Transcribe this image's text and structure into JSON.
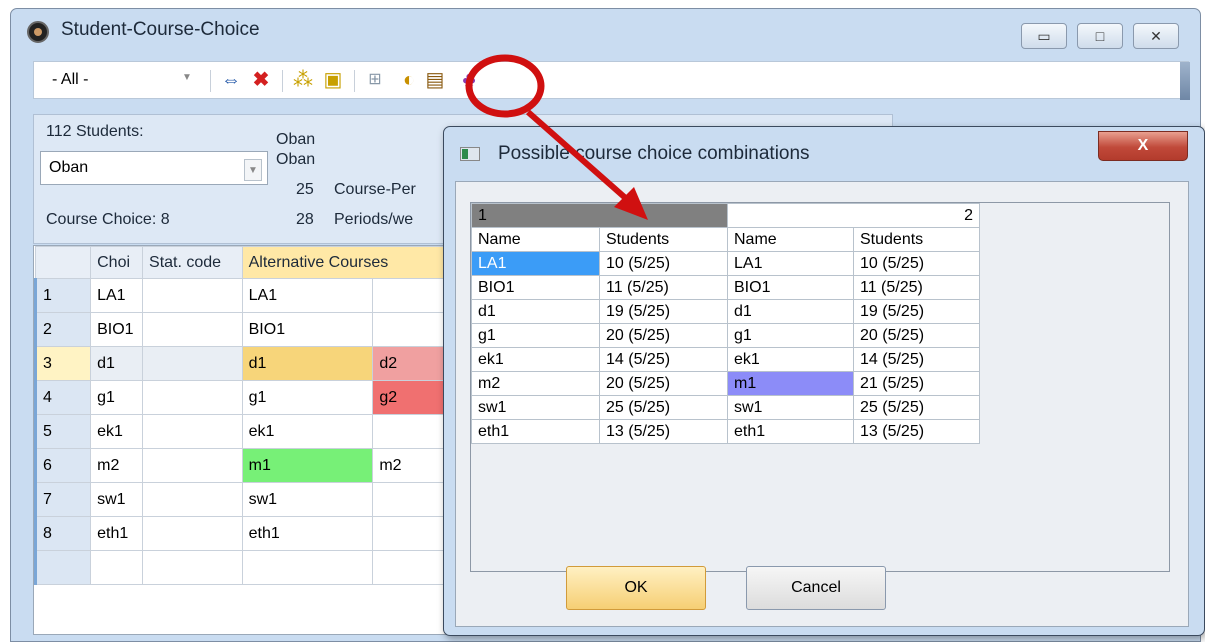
{
  "window": {
    "title": "Student-Course-Choice",
    "minimize_label": "▭",
    "maximize_label": "□",
    "close_label": "✕"
  },
  "toolbar": {
    "filter_value": "- All -"
  },
  "panel": {
    "students_count": "112 Students:",
    "class_value": "Oban",
    "name1": "Oban",
    "name2": "Oban",
    "num1": "25",
    "label1": "Course-Per",
    "num2": "28",
    "label2": "Periods/we",
    "course_choice": "Course Choice: 8"
  },
  "grid": {
    "headers": [
      "",
      "Choi",
      "Stat. code",
      "Alternative Courses",
      ""
    ],
    "rows": [
      {
        "n": "1",
        "choice": "LA1",
        "alt": "LA1",
        "alt2": ""
      },
      {
        "n": "2",
        "choice": "BIO1",
        "alt": "BIO1",
        "alt2": ""
      },
      {
        "n": "3",
        "choice": "d1",
        "alt": "d1",
        "alt2": "d2"
      },
      {
        "n": "4",
        "choice": "g1",
        "alt": "g1",
        "alt2": "g2"
      },
      {
        "n": "5",
        "choice": "ek1",
        "alt": "ek1",
        "alt2": ""
      },
      {
        "n": "6",
        "choice": "m2",
        "alt": "m1",
        "alt2": "m2"
      },
      {
        "n": "7",
        "choice": "sw1",
        "alt": "sw1",
        "alt2": ""
      },
      {
        "n": "8",
        "choice": "eth1",
        "alt": "eth1",
        "alt2": ""
      }
    ]
  },
  "dialog": {
    "title": "Possible course choice combinations",
    "close_label": "X",
    "group1": "1",
    "group2": "2",
    "col_name": "Name",
    "col_students": "Students",
    "rows": [
      {
        "n1": "LA1",
        "s1": "10 (5/25)",
        "n2": "LA1",
        "s2": "10 (5/25)"
      },
      {
        "n1": "BIO1",
        "s1": "11 (5/25)",
        "n2": "BIO1",
        "s2": "11 (5/25)"
      },
      {
        "n1": "d1",
        "s1": "19 (5/25)",
        "n2": "d1",
        "s2": "19 (5/25)"
      },
      {
        "n1": "g1",
        "s1": "20 (5/25)",
        "n2": "g1",
        "s2": "20 (5/25)"
      },
      {
        "n1": "ek1",
        "s1": "14 (5/25)",
        "n2": "ek1",
        "s2": "14 (5/25)"
      },
      {
        "n1": "m2",
        "s1": "20 (5/25)",
        "n2": "m1",
        "s2": "21 (5/25)"
      },
      {
        "n1": "sw1",
        "s1": "25 (5/25)",
        "n2": "sw1",
        "s2": "25 (5/25)"
      },
      {
        "n1": "eth1",
        "s1": "13 (5/25)",
        "n2": "eth1",
        "s2": "13 (5/25)"
      }
    ],
    "ok_label": "OK",
    "cancel_label": "Cancel"
  },
  "colors": {
    "highlight_orange": "#f7d57a",
    "highlight_red": "#f08080",
    "highlight_green": "#77f077",
    "selected_blue": "#3b9cf7",
    "selected_purple": "#8c8cf8",
    "annotation_red": "#d01010"
  }
}
